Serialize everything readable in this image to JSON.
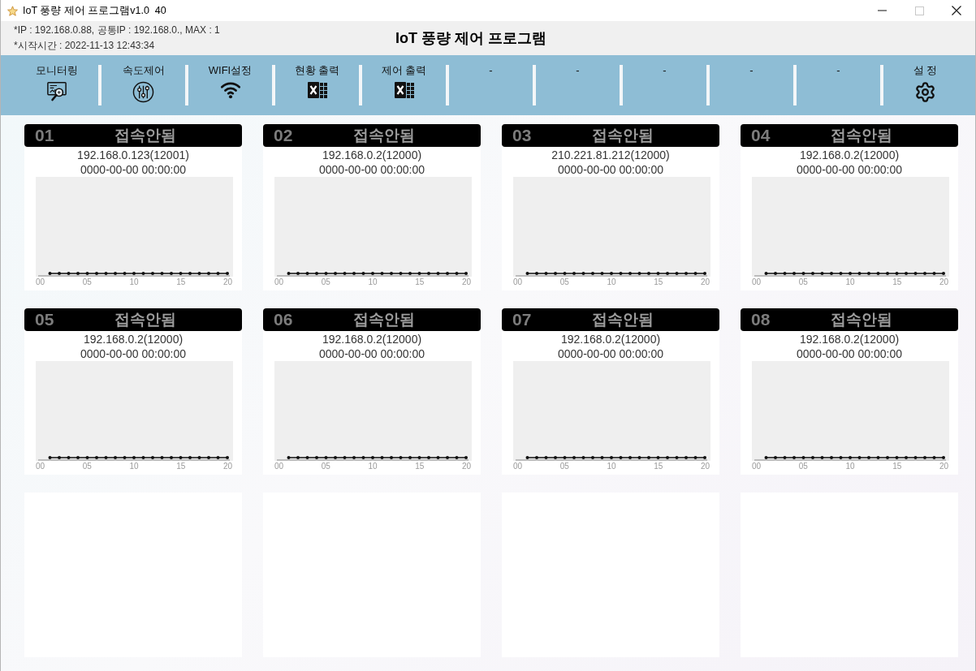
{
  "window": {
    "title": "IoT 풍량 제어 프로그램v1.0  40",
    "controls": [
      {
        "kind": "minimize",
        "disabled": false
      },
      {
        "kind": "maximize",
        "disabled": true
      },
      {
        "kind": "close",
        "disabled": false
      }
    ]
  },
  "info_bar": {
    "lines": [
      "*IP : 192.168.0.88, 공통IP : 192.168.0., MAX : 1",
      "*시작시간 : 2022-11-13 12:43:34"
    ],
    "heading": "IoT 풍량 제어 프로그램"
  },
  "toolbar": [
    {
      "label": "모니터링",
      "kind": "monitor"
    },
    {
      "label": "속도제어",
      "kind": "mixer"
    },
    {
      "label": "WIFI설정",
      "kind": "wifi"
    },
    {
      "label": "현황 출력",
      "kind": "spreadsheet"
    },
    {
      "label": "제어 출력",
      "kind": "spreadsheet"
    },
    {
      "label": "-",
      "kind": "none"
    },
    {
      "label": "-",
      "kind": "none"
    },
    {
      "label": "-",
      "kind": "none"
    },
    {
      "label": "-",
      "kind": "none"
    },
    {
      "label": "-",
      "kind": "none"
    },
    {
      "label": "설 정",
      "kind": "settings"
    }
  ],
  "panels": [
    {
      "kind": "device",
      "number": "01",
      "status": "접속안됨",
      "address": "192.168.0.123(12001)",
      "timestamp": "0000-00-00 00:00:00",
      "axis_labels": [
        "00",
        "05",
        "10",
        "15",
        "20"
      ]
    },
    {
      "kind": "device",
      "number": "02",
      "status": "접속안됨",
      "address": "192.168.0.2(12000)",
      "timestamp": "0000-00-00 00:00:00",
      "axis_labels": [
        "00",
        "05",
        "10",
        "15",
        "20"
      ]
    },
    {
      "kind": "device",
      "number": "03",
      "status": "접속안됨",
      "address": "210.221.81.212(12000)",
      "timestamp": "0000-00-00 00:00:00",
      "axis_labels": [
        "00",
        "05",
        "10",
        "15",
        "20"
      ]
    },
    {
      "kind": "device",
      "number": "04",
      "status": "접속안됨",
      "address": "192.168.0.2(12000)",
      "timestamp": "0000-00-00 00:00:00",
      "axis_labels": [
        "00",
        "05",
        "10",
        "15",
        "20"
      ]
    },
    {
      "kind": "device",
      "number": "05",
      "status": "접속안됨",
      "address": "192.168.0.2(12000)",
      "timestamp": "0000-00-00 00:00:00",
      "axis_labels": [
        "00",
        "05",
        "10",
        "15",
        "20"
      ]
    },
    {
      "kind": "device",
      "number": "06",
      "status": "접속안됨",
      "address": "192.168.0.2(12000)",
      "timestamp": "0000-00-00 00:00:00",
      "axis_labels": [
        "00",
        "05",
        "10",
        "15",
        "20"
      ]
    },
    {
      "kind": "device",
      "number": "07",
      "status": "접속안됨",
      "address": "192.168.0.2(12000)",
      "timestamp": "0000-00-00 00:00:00",
      "axis_labels": [
        "00",
        "05",
        "10",
        "15",
        "20"
      ]
    },
    {
      "kind": "device",
      "number": "08",
      "status": "접속안됨",
      "address": "192.168.0.2(12000)",
      "timestamp": "0000-00-00 00:00:00",
      "axis_labels": [
        "00",
        "05",
        "10",
        "15",
        "20"
      ]
    },
    {
      "kind": "empty"
    },
    {
      "kind": "empty"
    },
    {
      "kind": "empty"
    },
    {
      "kind": "empty"
    }
  ]
}
